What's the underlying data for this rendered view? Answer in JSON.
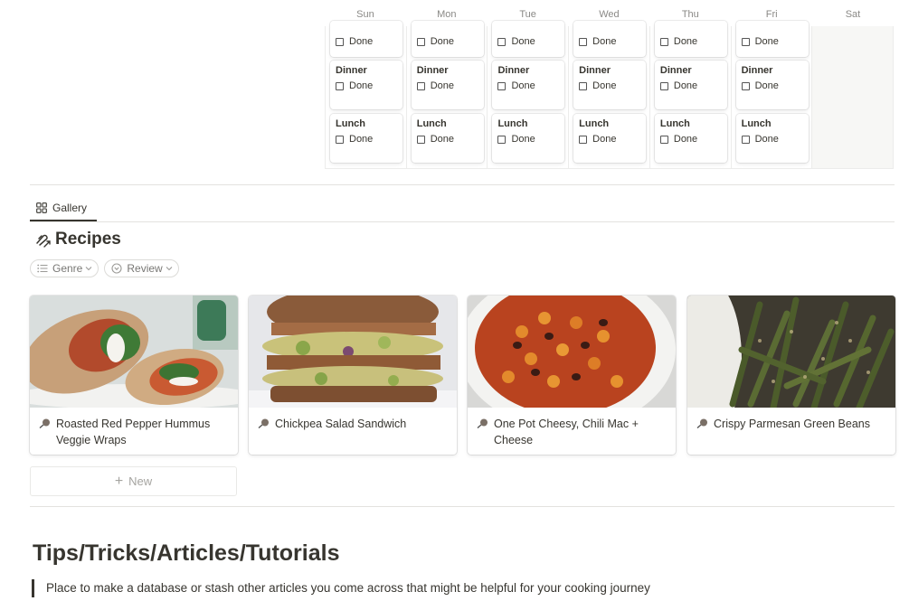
{
  "calendar": {
    "days": [
      "Sun",
      "Mon",
      "Tue",
      "Wed",
      "Thu",
      "Fri",
      "Sat"
    ],
    "done_label": "Done",
    "row2_label": "Dinner",
    "row3_label": "Lunch"
  },
  "view_tab": {
    "label": "Gallery"
  },
  "database": {
    "title": "Recipes"
  },
  "filters": [
    {
      "label": "Genre"
    },
    {
      "label": "Review"
    }
  ],
  "cards": [
    {
      "title": "Roasted Red Pepper Hummus Veggie Wraps"
    },
    {
      "title": "Chickpea Salad Sandwich"
    },
    {
      "title": "One Pot Cheesy, Chili Mac + Cheese"
    },
    {
      "title": "Crispy Parmesan Green Beans"
    }
  ],
  "new_button": {
    "label": "New"
  },
  "section": {
    "heading": "Tips/Tricks/Articles/Tutorials",
    "quote": "Place to make a database or stash other articles you come across that might be helpful for your cooking journey"
  },
  "colors": {
    "text": "#37352f",
    "muted": "#8a8986",
    "border": "#e3e2df",
    "sat_bg": "#f7f7f5"
  }
}
